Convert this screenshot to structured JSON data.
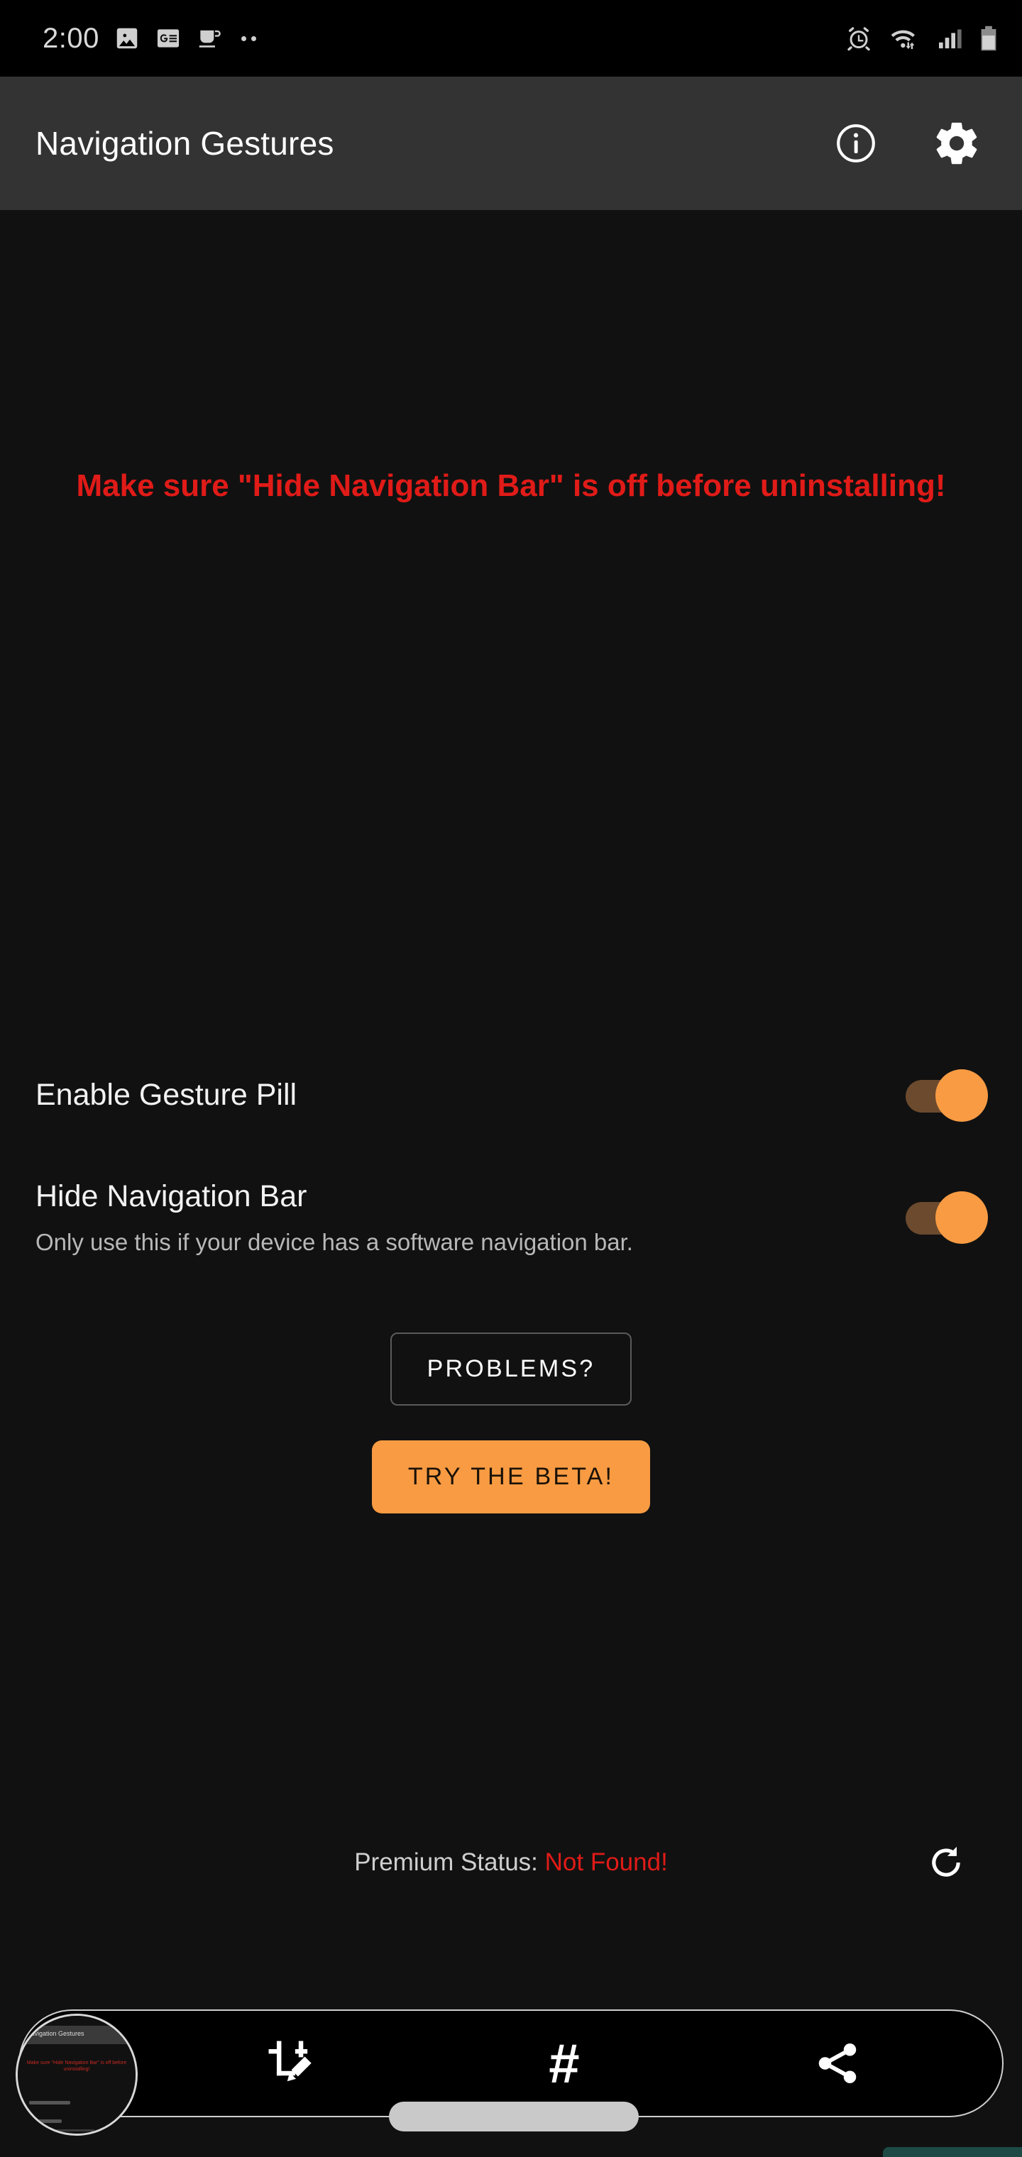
{
  "status_bar": {
    "clock": "2:00",
    "left_icons": [
      "image-icon",
      "google-news-icon",
      "coffee-cup-icon",
      "more-notifications-dots"
    ],
    "right_icons": [
      "alarm-icon",
      "wifi-icon",
      "signal-icon",
      "battery-icon"
    ]
  },
  "app_bar": {
    "title": "Navigation Gestures",
    "info_icon": "info-icon",
    "settings_icon": "gear-icon"
  },
  "main": {
    "warning": "Make sure \"Hide Navigation Bar\" is off before uninstalling!",
    "preferences": [
      {
        "title": "Enable Gesture Pill",
        "subtitle": "",
        "state": "on"
      },
      {
        "title": "Hide Navigation Bar",
        "subtitle": "Only use this if your device has a software navigation bar.",
        "state": "on"
      }
    ],
    "problems_button": "PROBLEMS?",
    "beta_button": "TRY THE BETA!",
    "premium_label": "Premium Status:",
    "premium_value": "Not Found!",
    "refresh_icon": "refresh-icon"
  },
  "screenshot_toolbar": {
    "thumbnail_title": "Navigation Gestures",
    "thumbnail_warning": "Make sure \"Hide Navigation Bar\" is off before uninstalling!",
    "crop_icon": "crop-edit-icon",
    "tag_icon": "hashtag-icon",
    "tag_glyph": "#",
    "share_icon": "share-icon"
  },
  "colors": {
    "accent": "#f89b43",
    "warning": "#e01b18",
    "app_bar": "#333333",
    "background": "#111111",
    "switch_track": "#6b4a2e"
  }
}
